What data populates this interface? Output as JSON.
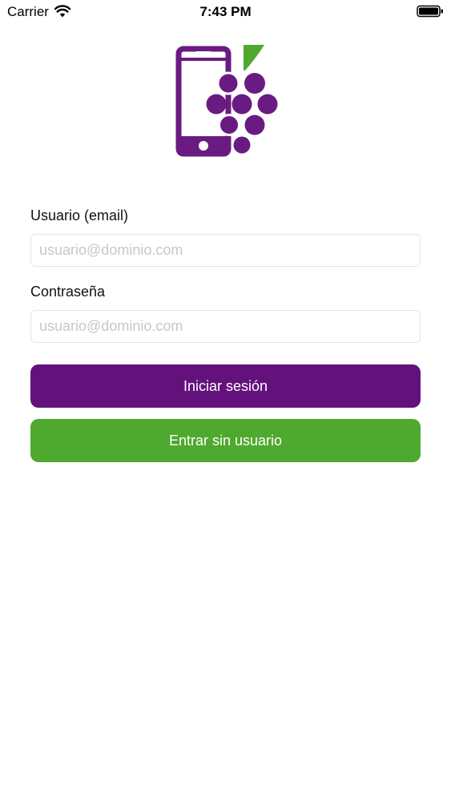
{
  "status_bar": {
    "carrier": "Carrier",
    "time": "7:43 PM",
    "icons": [
      "wifi-icon",
      "battery-icon"
    ]
  },
  "logo": {
    "icons": [
      "phone-icon",
      "grapes-icon",
      "leaf-icon"
    ],
    "colors": {
      "purple": "#6a1b82",
      "green": "#4ea92e"
    }
  },
  "login_form": {
    "user_label": "Usuario (email)",
    "user_placeholder": "usuario@dominio.com",
    "user_value": "",
    "password_label": "Contraseña",
    "password_placeholder": "usuario@dominio.com",
    "password_value": "",
    "login_button": "Iniciar sesión",
    "guest_button": "Entrar sin usuario"
  },
  "colors": {
    "login_button_bg": "#63127d",
    "guest_button_bg": "#4ea92e",
    "input_border": "#e3e3e6",
    "placeholder": "#c7c7cd"
  }
}
